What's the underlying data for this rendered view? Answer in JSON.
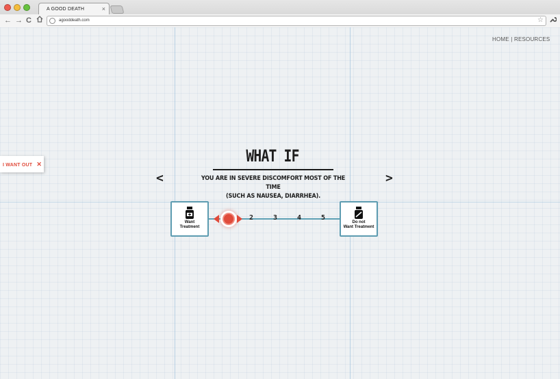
{
  "browser": {
    "tab_title": "A GOOD DEATH",
    "tab_close": "×",
    "url": "agooddeath.com",
    "nav_back": "←",
    "nav_forward": "→",
    "nav_reload": "C",
    "star": "☆",
    "traffic_colors": [
      "#ee5b4f",
      "#f4bd3d",
      "#67c23f"
    ]
  },
  "nav": {
    "home": "HOME",
    "separator": "|",
    "resources": "RESOURCES"
  },
  "exit_tab": {
    "label": "I WANT OUT",
    "icon": "close-icon",
    "close_glyph": "✕"
  },
  "question": {
    "heading": "WHAT IF",
    "line1": "YOU ARE IN SEVERE DISCOMFORT MOST OF THE TIME",
    "line2": "(SUCH AS NAUSEA, DIARRHEA).",
    "prev_glyph": "<",
    "next_glyph": ">"
  },
  "scale": {
    "left_option": {
      "line1": "Want",
      "line2": "Treatment",
      "icon": "medicine-bottle-icon"
    },
    "right_option": {
      "line1": "Do not",
      "line2": "Want Treatment",
      "icon": "medicine-bottle-crossed-icon"
    },
    "steps": [
      "2",
      "3",
      "4",
      "5"
    ],
    "selected_step": 1
  },
  "colors": {
    "accent": "#e04a3a",
    "border": "#5c9bb0",
    "track": "#5ea0b4"
  }
}
